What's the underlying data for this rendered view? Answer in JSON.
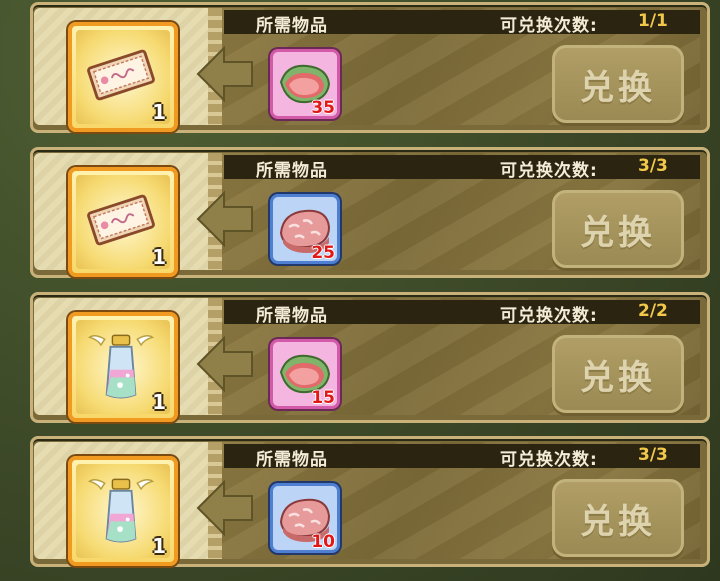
{
  "rows": [
    {
      "required_label": "所需物品",
      "count_label": "可兑换次数:",
      "count": "1/1",
      "reward": {
        "icon": "ticket-icon",
        "qty": "1"
      },
      "required": {
        "icon": "meat-icon",
        "qty": "35",
        "frame": "pink"
      },
      "button": "兑换"
    },
    {
      "required_label": "所需物品",
      "count_label": "可兑换次数:",
      "count": "3/3",
      "reward": {
        "icon": "ticket-icon",
        "qty": "1"
      },
      "required": {
        "icon": "marbled-meat-icon",
        "qty": "25",
        "frame": "blue"
      },
      "button": "兑换"
    },
    {
      "required_label": "所需物品",
      "count_label": "可兑换次数:",
      "count": "2/2",
      "reward": {
        "icon": "winged-bottle-icon",
        "qty": "1"
      },
      "required": {
        "icon": "meat-icon",
        "qty": "15",
        "frame": "pink"
      },
      "button": "兑换"
    },
    {
      "required_label": "所需物品",
      "count_label": "可兑换次数:",
      "count": "3/3",
      "reward": {
        "icon": "winged-bottle-icon",
        "qty": "1"
      },
      "required": {
        "icon": "marbled-meat-icon",
        "qty": "10",
        "frame": "blue"
      },
      "button": "兑换"
    }
  ],
  "colors": {
    "count": "#f2c84a",
    "req_qty": "#e01818",
    "pink_frame": "#d35aa8",
    "blue_frame": "#4f7fd0"
  }
}
